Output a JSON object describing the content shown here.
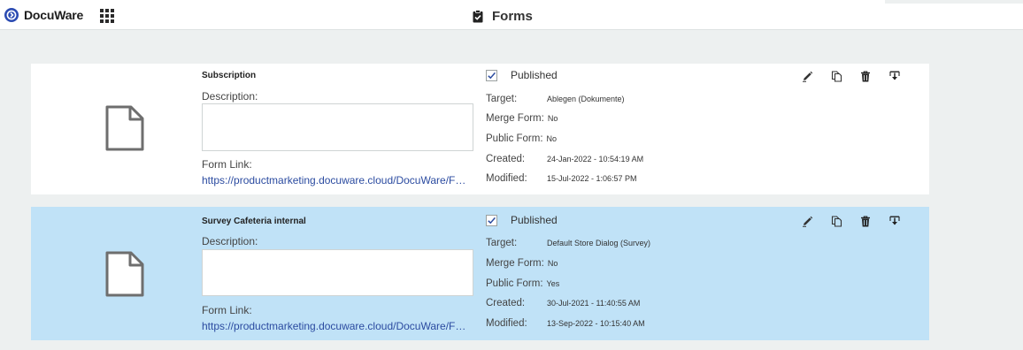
{
  "header": {
    "brand": "DocuWare",
    "title": "Forms"
  },
  "labels": {
    "description": "Description:",
    "form_link": "Form Link:",
    "published": "Published",
    "target": "Target:",
    "merge_form": "Merge Form:",
    "public_form": "Public Form:",
    "created": "Created:",
    "modified": "Modified:"
  },
  "forms": [
    {
      "name": "Subscription",
      "description": "",
      "link": "https://productmarketing.docuware.cloud/DocuWare/Forms/Subscription",
      "published": true,
      "target": "Ablegen (Dokumente)",
      "merge_form": "No",
      "public_form": "No",
      "created": "24-Jan-2022 - 10:54:19 AM",
      "modified": "15-Jul-2022 - 1:06:57 PM"
    },
    {
      "name": "Survey Cafeteria internal",
      "description": "",
      "link": "https://productmarketing.docuware.cloud/DocuWare/Forms/Survey-Cafeteria-internal",
      "published": true,
      "target": "Default Store Dialog (Survey)",
      "merge_form": "No",
      "public_form": "Yes",
      "created": "30-Jul-2021 - 11:40:55 AM",
      "modified": "13-Sep-2022 - 10:15:40 AM"
    }
  ],
  "colors": {
    "brand_blue": "#2b4bb2",
    "selected_row": "#c0e2f7",
    "link": "#2b4ba0"
  }
}
